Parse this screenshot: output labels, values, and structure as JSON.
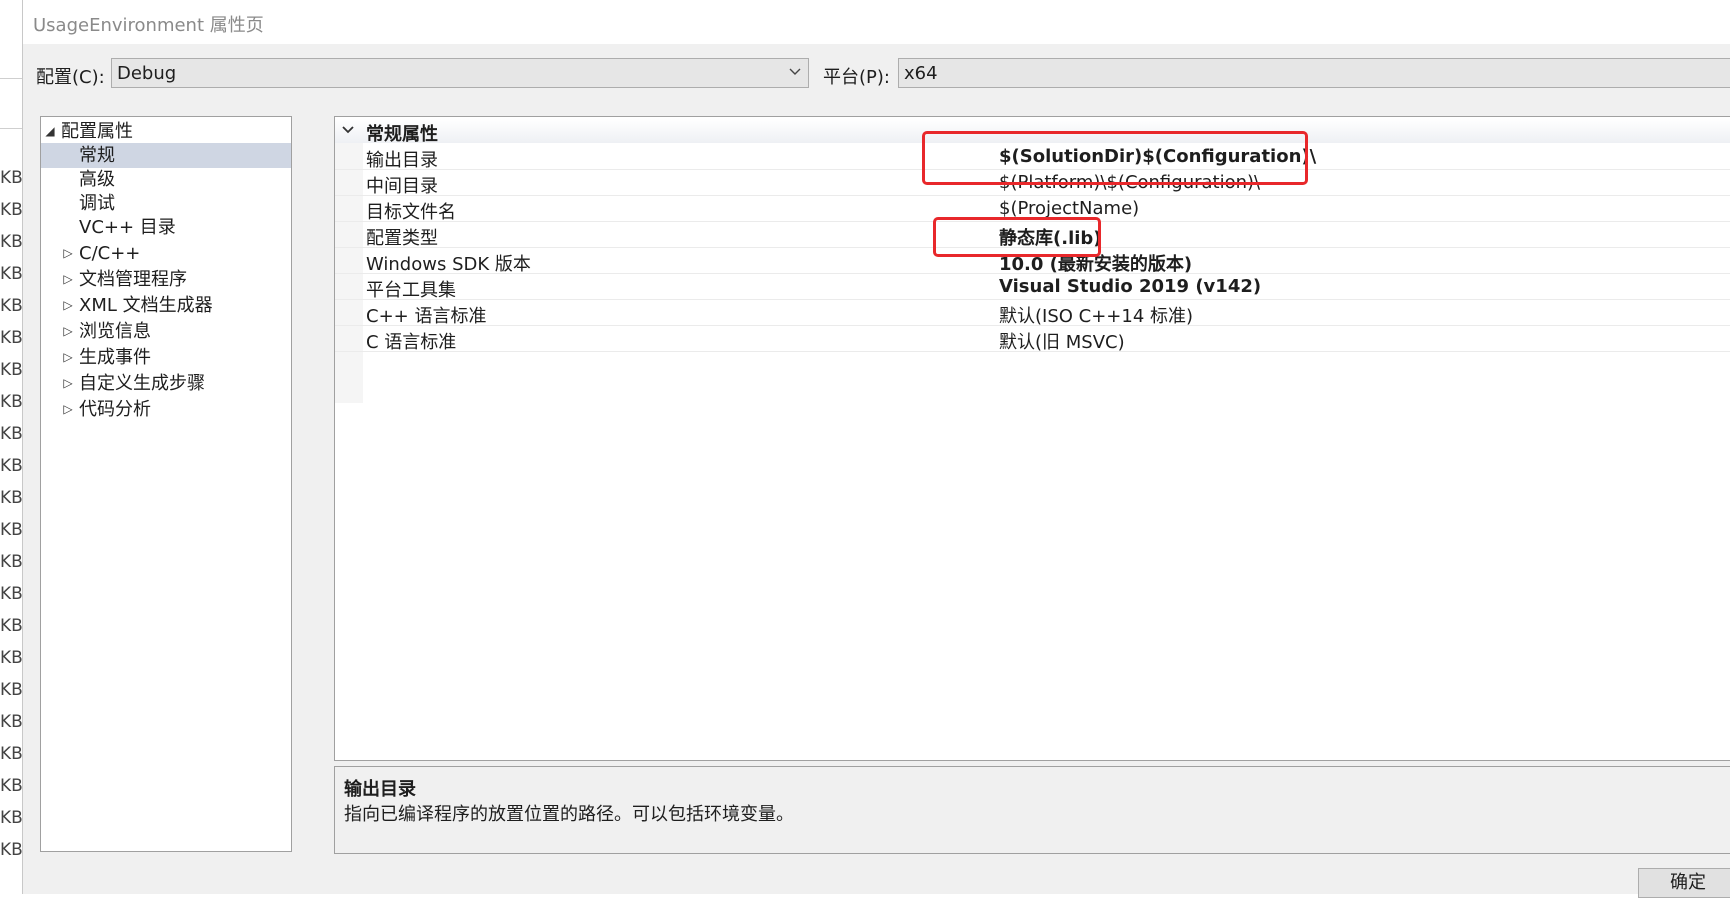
{
  "background_window": {
    "size_labels": [
      "KB",
      "KB",
      "KB",
      "KB",
      "KB",
      "KB",
      "KB",
      "KB",
      "KB",
      "KB",
      "KB",
      "KB",
      "KB",
      "KB",
      "KB",
      "KB",
      "KB",
      "KB",
      "KB",
      "KB",
      "KB",
      "KB"
    ]
  },
  "dialog": {
    "title": "UsageEnvironment 属性页",
    "config_label": "配置(C):",
    "config_value": "Debug",
    "platform_label": "平台(P):",
    "platform_value": "x64"
  },
  "tree": {
    "items": [
      {
        "label": "配置属性",
        "expander": "◢"
      },
      {
        "label": "常规",
        "expander": ""
      },
      {
        "label": "高级",
        "expander": ""
      },
      {
        "label": "调试",
        "expander": ""
      },
      {
        "label": "VC++ 目录",
        "expander": ""
      },
      {
        "label": "C/C++",
        "expander": "▷"
      },
      {
        "label": "文档管理程序",
        "expander": "▷"
      },
      {
        "label": "XML 文档生成器",
        "expander": "▷"
      },
      {
        "label": "浏览信息",
        "expander": "▷"
      },
      {
        "label": "生成事件",
        "expander": "▷"
      },
      {
        "label": "自定义生成步骤",
        "expander": "▷"
      },
      {
        "label": "代码分析",
        "expander": "▷"
      }
    ]
  },
  "grid": {
    "section": "常规属性",
    "rows": [
      {
        "name": "输出目录",
        "value": "$(SolutionDir)$(Configuration)\\"
      },
      {
        "name": "中间目录",
        "value": "$(Platform)\\$(Configuration)\\"
      },
      {
        "name": "目标文件名",
        "value": "$(ProjectName)"
      },
      {
        "name": "配置类型",
        "value": "静态库(.lib)"
      },
      {
        "name": "Windows SDK 版本",
        "value": "10.0 (最新安装的版本)"
      },
      {
        "name": "平台工具集",
        "value": "Visual Studio 2019 (v142)"
      },
      {
        "name": "C++ 语言标准",
        "value": "默认(ISO C++14 标准)"
      },
      {
        "name": "C 语言标准",
        "value": "默认(旧 MSVC)"
      }
    ]
  },
  "description": {
    "title": "输出目录",
    "text": "指向已编译程序的放置位置的路径。可以包括环境变量。"
  },
  "buttons": {
    "ok": "确定"
  },
  "colors": {
    "annotation": "#e8282b",
    "selection": "#cfd6e3"
  }
}
